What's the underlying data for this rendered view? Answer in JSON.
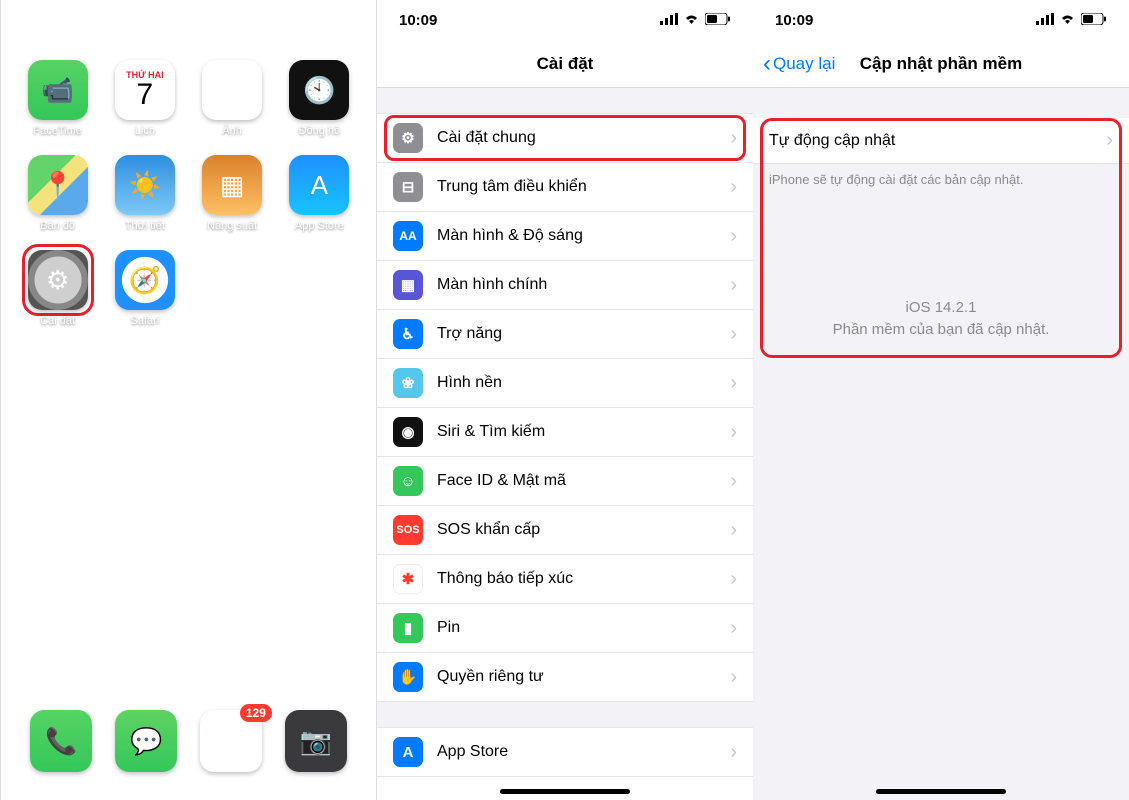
{
  "status": {
    "time": "10:09"
  },
  "home": {
    "calendar_dow": "THỨ HAI",
    "calendar_day": "7",
    "apps": [
      {
        "label": "FaceTime",
        "name": "facetime",
        "bg": "bg-green",
        "glyph": "📹"
      },
      {
        "label": "Lịch",
        "name": "calendar",
        "bg": "cal",
        "glyph": ""
      },
      {
        "label": "Ảnh",
        "name": "photos",
        "bg": "photos-flower",
        "glyph": "✿"
      },
      {
        "label": "Đồng hồ",
        "name": "clock",
        "bg": "bg-clock",
        "glyph": "🕙"
      },
      {
        "label": "Bản đồ",
        "name": "maps",
        "bg": "bg-maps",
        "glyph": "📍"
      },
      {
        "label": "Thời tiết",
        "name": "weather",
        "bg": "bg-weather",
        "glyph": "☀️"
      },
      {
        "label": "Năng suất",
        "name": "productivity",
        "bg": "bg-ns",
        "glyph": "▦"
      },
      {
        "label": "App Store",
        "name": "app-store",
        "bg": "bg-appstore",
        "glyph": "A"
      },
      {
        "label": "Cài đặt",
        "name": "settings",
        "bg": "bg-settings",
        "glyph": "⚙︎",
        "highlight": true
      },
      {
        "label": "Safari",
        "name": "safari",
        "bg": "bg-safari",
        "glyph": "🧭"
      }
    ],
    "dock": [
      {
        "name": "phone",
        "bg": "bg-green",
        "glyph": "📞"
      },
      {
        "name": "messages",
        "bg": "bg-msg",
        "glyph": "💬"
      },
      {
        "name": "folder",
        "bg": "bg-folder",
        "glyph": "▦",
        "badge": "129"
      },
      {
        "name": "camera",
        "bg": "bg-cam",
        "glyph": "📷"
      }
    ]
  },
  "settings": {
    "title": "Cài đặt",
    "rows1": [
      {
        "icon": "ic-gear",
        "glyph": "⚙︎",
        "label": "Cài đặt chung",
        "name": "general",
        "highlight": true
      },
      {
        "icon": "ic-cc",
        "glyph": "⊟",
        "label": "Trung tâm điều khiển",
        "name": "control-center"
      },
      {
        "icon": "ic-aa",
        "glyph": "AA",
        "label": "Màn hình & Độ sáng",
        "name": "display"
      },
      {
        "icon": "ic-home",
        "glyph": "▦",
        "label": "Màn hình chính",
        "name": "home-screen"
      },
      {
        "icon": "ic-acc",
        "glyph": "♿︎",
        "label": "Trợ năng",
        "name": "accessibility"
      },
      {
        "icon": "ic-wall",
        "glyph": "❀",
        "label": "Hình nền",
        "name": "wallpaper"
      },
      {
        "icon": "ic-siri",
        "glyph": "◉",
        "label": "Siri & Tìm kiếm",
        "name": "siri"
      },
      {
        "icon": "ic-face",
        "glyph": "☺︎",
        "label": "Face ID & Mật mã",
        "name": "faceid"
      },
      {
        "icon": "ic-sos",
        "glyph": "SOS",
        "label": "SOS khẩn cấp",
        "name": "sos"
      },
      {
        "icon": "ic-en",
        "glyph": "✱",
        "label": "Thông báo tiếp xúc",
        "name": "exposure"
      },
      {
        "icon": "ic-bat",
        "glyph": "▮",
        "label": "Pin",
        "name": "battery"
      },
      {
        "icon": "ic-priv",
        "glyph": "✋",
        "label": "Quyền riêng tư",
        "name": "privacy"
      }
    ],
    "rows2": [
      {
        "icon": "ic-as",
        "glyph": "A",
        "label": "App Store",
        "name": "store"
      }
    ]
  },
  "update": {
    "back": "Quay lại",
    "title": "Cập nhật phần mềm",
    "auto_row": "Tự động cập nhật",
    "auto_note": "iPhone sẽ tự động cài đặt các bản cập nhật.",
    "version": "iOS 14.2.1",
    "msg": "Phần mềm của bạn đã cập nhật."
  }
}
